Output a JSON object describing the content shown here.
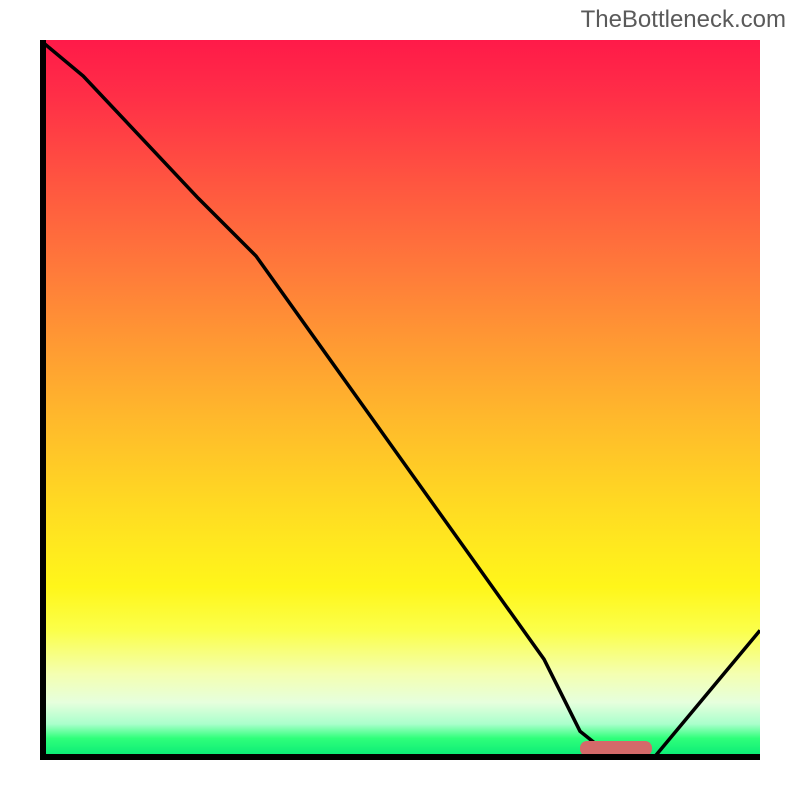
{
  "watermark": "TheBottleneck.com",
  "chart_data": {
    "type": "line",
    "title": "",
    "xlabel": "",
    "ylabel": "",
    "xlim": [
      0,
      100
    ],
    "ylim": [
      0,
      100
    ],
    "series": [
      {
        "name": "bottleneck-curve",
        "x": [
          0,
          6,
          22,
          30,
          40,
          50,
          60,
          70,
          75,
          80,
          85,
          100
        ],
        "values": [
          100,
          95,
          78,
          70,
          56,
          42,
          28,
          14,
          4,
          0,
          0,
          18
        ]
      }
    ],
    "marker": {
      "x_start": 75,
      "x_end": 85,
      "y": 0
    },
    "gradient": {
      "stops": [
        {
          "pos": 0.0,
          "color": "#ff1a49"
        },
        {
          "pos": 0.2,
          "color": "#ff5640"
        },
        {
          "pos": 0.42,
          "color": "#ff9933"
        },
        {
          "pos": 0.62,
          "color": "#ffd324"
        },
        {
          "pos": 0.82,
          "color": "#fbff4a"
        },
        {
          "pos": 0.95,
          "color": "#aaffcc"
        },
        {
          "pos": 1.0,
          "color": "#00e676"
        }
      ]
    }
  }
}
